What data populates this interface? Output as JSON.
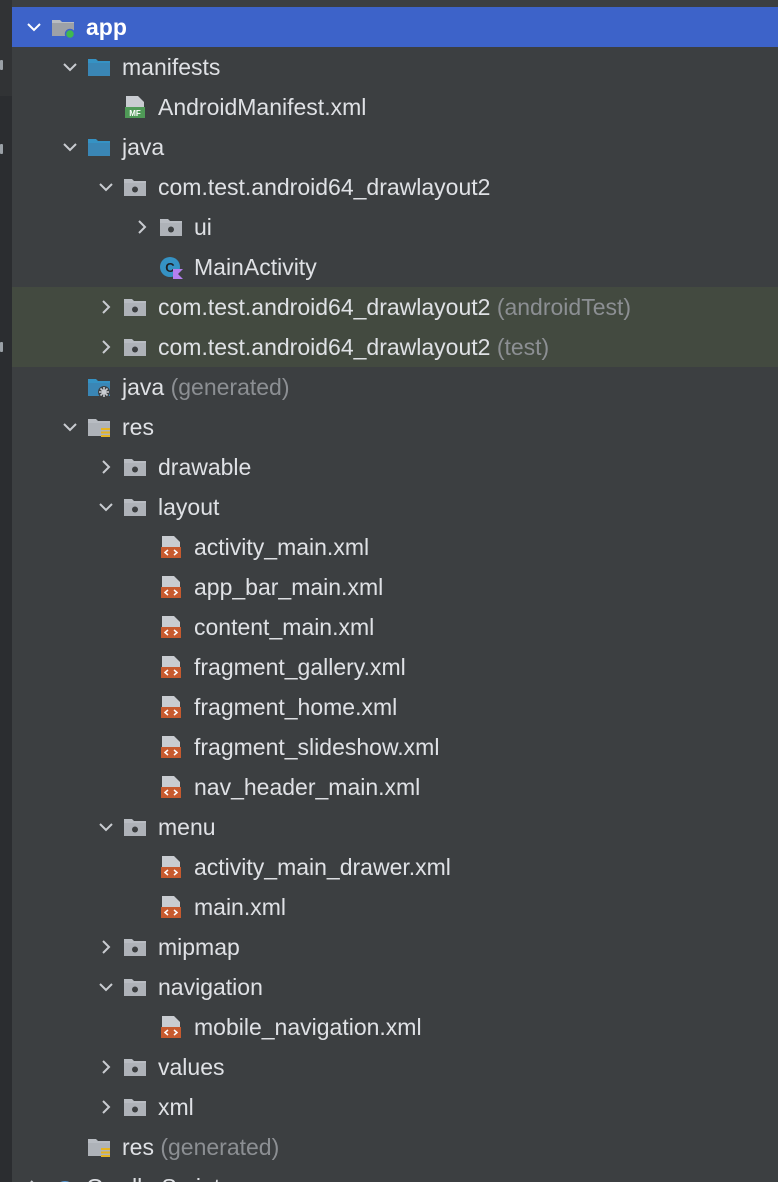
{
  "colors": {
    "background": "#3c3f41",
    "selected": "#3d63c9",
    "highlight": "#434a40",
    "text": "#dfe1e5",
    "hint": "#8c8f93",
    "folder_blue": "#3592c4",
    "folder_gray": "#b8bcc2",
    "layout_file": "#c75a2e",
    "manifest_green": "#4f9a57"
  },
  "tree": [
    {
      "label": "app",
      "hint": "",
      "depth": 0,
      "arrow": "down",
      "icon": "module-folder-icon",
      "state": "selected"
    },
    {
      "label": "manifests",
      "hint": "",
      "depth": 1,
      "arrow": "down",
      "icon": "folder-blue-icon",
      "state": ""
    },
    {
      "label": "AndroidManifest.xml",
      "hint": "",
      "depth": 2,
      "arrow": "",
      "icon": "manifest-file-icon",
      "state": ""
    },
    {
      "label": "java",
      "hint": "",
      "depth": 1,
      "arrow": "down",
      "icon": "folder-blue-icon",
      "state": ""
    },
    {
      "label": "com.test.android64_drawlayout2",
      "hint": "",
      "depth": 2,
      "arrow": "down",
      "icon": "package-folder-icon",
      "state": ""
    },
    {
      "label": "ui",
      "hint": "",
      "depth": 3,
      "arrow": "right",
      "icon": "package-folder-icon",
      "state": ""
    },
    {
      "label": "MainActivity",
      "hint": "",
      "depth": 3,
      "arrow": "",
      "icon": "kotlin-class-icon",
      "state": ""
    },
    {
      "label": "com.test.android64_drawlayout2",
      "hint": "(androidTest)",
      "depth": 2,
      "arrow": "right",
      "icon": "package-folder-icon",
      "state": "hilite"
    },
    {
      "label": "com.test.android64_drawlayout2",
      "hint": "(test)",
      "depth": 2,
      "arrow": "right",
      "icon": "package-folder-icon",
      "state": "hilite"
    },
    {
      "label": "java",
      "hint": "(generated)",
      "depth": 1,
      "arrow": "",
      "icon": "generated-folder-icon",
      "state": ""
    },
    {
      "label": "res",
      "hint": "",
      "depth": 1,
      "arrow": "down",
      "icon": "resource-folder-icon",
      "state": ""
    },
    {
      "label": "drawable",
      "hint": "",
      "depth": 2,
      "arrow": "right",
      "icon": "package-folder-icon",
      "state": ""
    },
    {
      "label": "layout",
      "hint": "",
      "depth": 2,
      "arrow": "down",
      "icon": "package-folder-icon",
      "state": ""
    },
    {
      "label": "activity_main.xml",
      "hint": "",
      "depth": 3,
      "arrow": "",
      "icon": "layout-file-icon",
      "state": ""
    },
    {
      "label": "app_bar_main.xml",
      "hint": "",
      "depth": 3,
      "arrow": "",
      "icon": "layout-file-icon",
      "state": ""
    },
    {
      "label": "content_main.xml",
      "hint": "",
      "depth": 3,
      "arrow": "",
      "icon": "layout-file-icon",
      "state": ""
    },
    {
      "label": "fragment_gallery.xml",
      "hint": "",
      "depth": 3,
      "arrow": "",
      "icon": "layout-file-icon",
      "state": ""
    },
    {
      "label": "fragment_home.xml",
      "hint": "",
      "depth": 3,
      "arrow": "",
      "icon": "layout-file-icon",
      "state": ""
    },
    {
      "label": "fragment_slideshow.xml",
      "hint": "",
      "depth": 3,
      "arrow": "",
      "icon": "layout-file-icon",
      "state": ""
    },
    {
      "label": "nav_header_main.xml",
      "hint": "",
      "depth": 3,
      "arrow": "",
      "icon": "layout-file-icon",
      "state": ""
    },
    {
      "label": "menu",
      "hint": "",
      "depth": 2,
      "arrow": "down",
      "icon": "package-folder-icon",
      "state": ""
    },
    {
      "label": "activity_main_drawer.xml",
      "hint": "",
      "depth": 3,
      "arrow": "",
      "icon": "layout-file-icon",
      "state": ""
    },
    {
      "label": "main.xml",
      "hint": "",
      "depth": 3,
      "arrow": "",
      "icon": "layout-file-icon",
      "state": ""
    },
    {
      "label": "mipmap",
      "hint": "",
      "depth": 2,
      "arrow": "right",
      "icon": "package-folder-icon",
      "state": ""
    },
    {
      "label": "navigation",
      "hint": "",
      "depth": 2,
      "arrow": "down",
      "icon": "package-folder-icon",
      "state": ""
    },
    {
      "label": "mobile_navigation.xml",
      "hint": "",
      "depth": 3,
      "arrow": "",
      "icon": "layout-file-icon",
      "state": ""
    },
    {
      "label": "values",
      "hint": "",
      "depth": 2,
      "arrow": "right",
      "icon": "package-folder-icon",
      "state": ""
    },
    {
      "label": "xml",
      "hint": "",
      "depth": 2,
      "arrow": "right",
      "icon": "package-folder-icon",
      "state": ""
    },
    {
      "label": "res",
      "hint": "(generated)",
      "depth": 1,
      "arrow": "",
      "icon": "resource-folder-icon",
      "state": ""
    },
    {
      "label": "Gradle Scripts",
      "hint": "",
      "depth": 0,
      "arrow": "right",
      "icon": "gradle-icon",
      "state": ""
    }
  ]
}
